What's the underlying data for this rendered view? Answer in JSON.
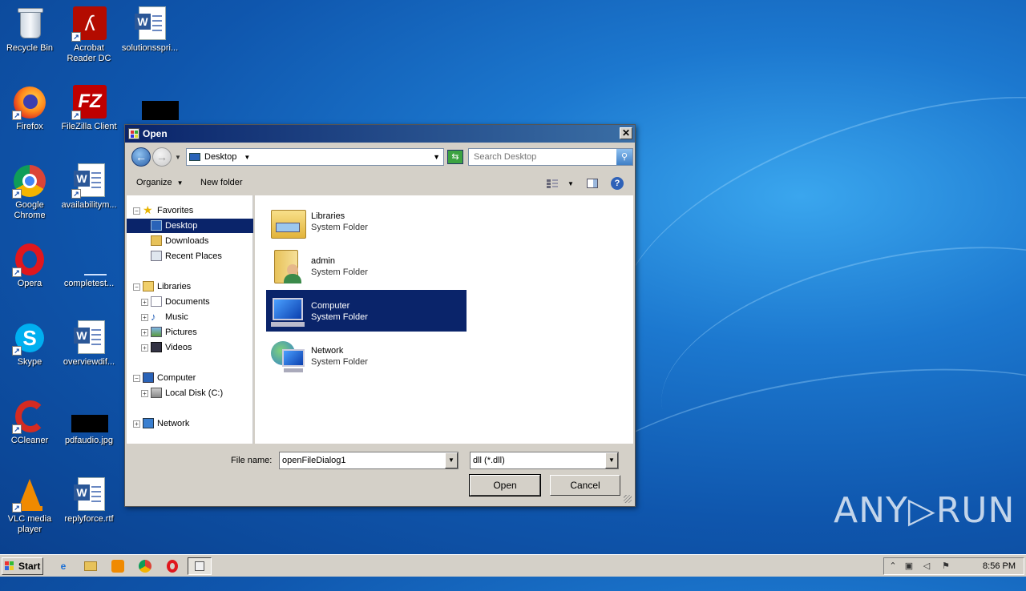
{
  "desktop_icons": [
    {
      "label": "Recycle Bin"
    },
    {
      "label": "Acrobat Reader DC"
    },
    {
      "label": "solutionsspri..."
    },
    {
      "label": "Firefox"
    },
    {
      "label": "FileZilla Client"
    },
    {
      "label": "Google Chrome"
    },
    {
      "label": "availabilitym..."
    },
    {
      "label": "Opera"
    },
    {
      "label": "completest..."
    },
    {
      "label": "Skype"
    },
    {
      "label": "overviewdif..."
    },
    {
      "label": "CCleaner"
    },
    {
      "label": "pdfaudio.jpg"
    },
    {
      "label": "VLC media player"
    },
    {
      "label": "replyforce.rtf"
    }
  ],
  "dialog": {
    "title": "Open",
    "close_glyph": "✕",
    "address": {
      "location": "Desktop"
    },
    "search": {
      "placeholder": "Search Desktop"
    },
    "toolbar": {
      "organize": "Organize",
      "new_folder": "New folder",
      "help": "?"
    },
    "nav_tree": [
      {
        "label": "Favorites"
      },
      {
        "label": "Desktop"
      },
      {
        "label": "Downloads"
      },
      {
        "label": "Recent Places"
      },
      {
        "label": "Libraries"
      },
      {
        "label": "Documents"
      },
      {
        "label": "Music"
      },
      {
        "label": "Pictures"
      },
      {
        "label": "Videos"
      },
      {
        "label": "Computer"
      },
      {
        "label": "Local Disk (C:)"
      },
      {
        "label": "Network"
      }
    ],
    "items": [
      {
        "name": "Libraries",
        "type": "System Folder"
      },
      {
        "name": "admin",
        "type": "System Folder"
      },
      {
        "name": "Computer",
        "type": "System Folder"
      },
      {
        "name": "Network",
        "type": "System Folder"
      }
    ],
    "file_name_label": "File name:",
    "file_name_value": "openFileDialog1",
    "file_type": "dll (*.dll)",
    "open_button": "Open",
    "cancel_button": "Cancel"
  },
  "taskbar": {
    "start_label": "Start",
    "clock": "8:56 PM"
  },
  "watermark": "ANY▷RUN"
}
